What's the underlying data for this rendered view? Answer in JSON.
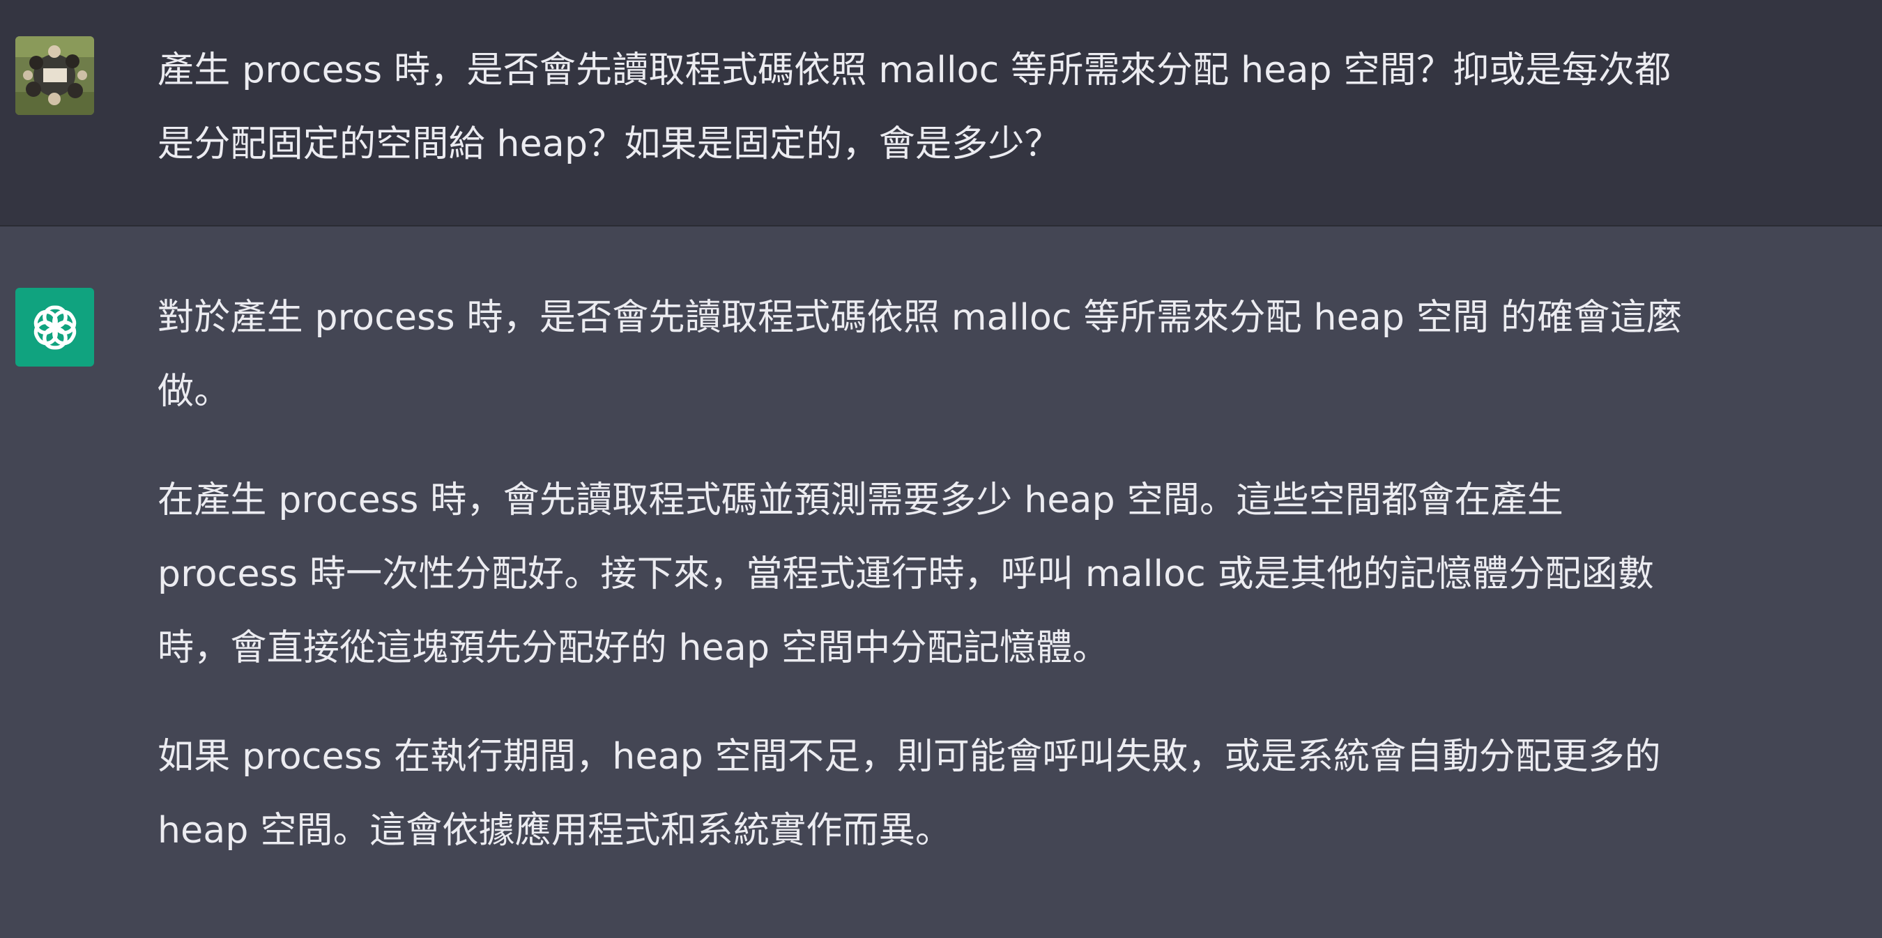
{
  "conversation": {
    "user_message": {
      "avatar_icon": "user-photo-avatar",
      "lines": [
        "產生 process 時，是否會先讀取程式碼依照 malloc 等所需來分配 heap 空間？抑或是每次都",
        "是分配固定的空間給 heap？如果是固定的，會是多少？"
      ]
    },
    "assistant_message": {
      "avatar_icon": "openai-logo-icon",
      "avatar_color": "#10a37f",
      "paragraphs": [
        "對於產生 process 時，是否會先讀取程式碼依照 malloc 等所需來分配 heap 空間 的確會這麼\n做。",
        "在產生 process 時，會先讀取程式碼並預測需要多少 heap 空間。這些空間都會在產生\nprocess 時一次性分配好。接下來，當程式運行時，呼叫 malloc 或是其他的記憶體分配函數\n時，會直接從這塊預先分配好的 heap 空間中分配記憶體。",
        "如果 process 在執行期間，heap 空間不足，則可能會呼叫失敗，或是系統會自動分配更多的\nheap 空間。這會依據應用程式和系統實作而異。"
      ]
    }
  },
  "colors": {
    "user_background": "#343541",
    "assistant_background": "#444654",
    "text": "#ececf1",
    "accent": "#10a37f"
  }
}
